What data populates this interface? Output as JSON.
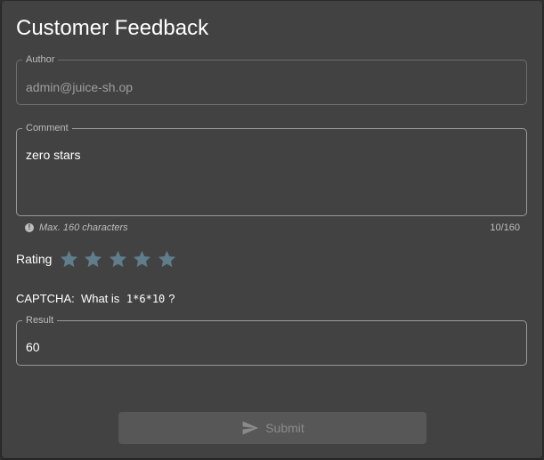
{
  "form": {
    "title": "Customer Feedback",
    "author": {
      "label": "Author",
      "value": "admin@juice-sh.op"
    },
    "comment": {
      "label": "Comment",
      "value": "zero stars",
      "hint": "Max. 160 characters",
      "counter": "10/160"
    },
    "rating": {
      "label": "Rating",
      "stars_total": 5,
      "stars_selected": 0
    },
    "captcha": {
      "prefix": "CAPTCHA:  What is",
      "expression": "1*6*10",
      "suffix": "?"
    },
    "result": {
      "label": "Result",
      "value": "60"
    },
    "submit_label": "Submit"
  },
  "colors": {
    "background": "#303030",
    "card": "#424242",
    "star": "#607d8b",
    "button_disabled": "#575757"
  },
  "icons": [
    "info-icon",
    "star-icon",
    "send-icon"
  ]
}
